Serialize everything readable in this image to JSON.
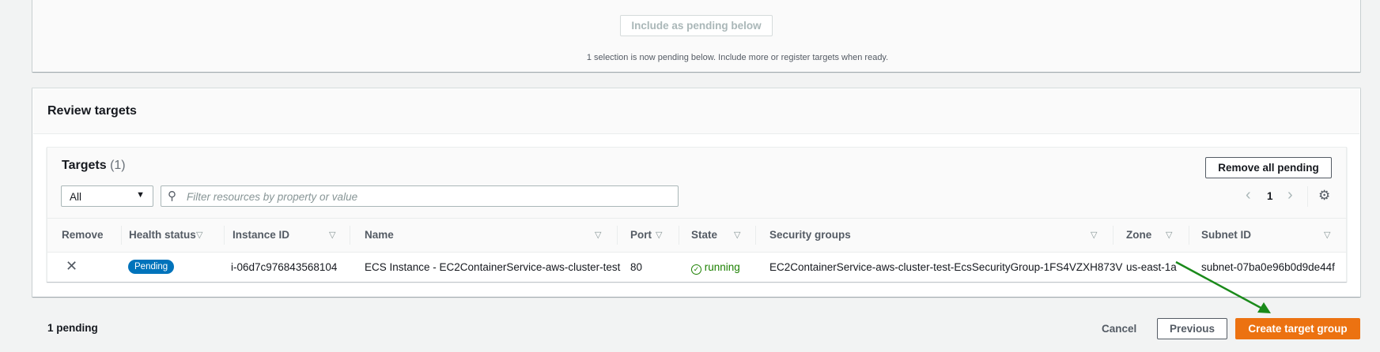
{
  "top_panel": {
    "include_button": "Include as pending below",
    "selection_text": "1 selection is now pending below. Include more or register targets when ready."
  },
  "review": {
    "title": "Review targets",
    "targets_title": "Targets",
    "targets_count": "(1)",
    "remove_all_button": "Remove all pending",
    "filter_select": "All",
    "filter_placeholder": "Filter resources by property or value",
    "page": "1",
    "columns": [
      "Remove",
      "Health status",
      "Instance ID",
      "Name",
      "Port",
      "State",
      "Security groups",
      "Zone",
      "Subnet ID"
    ],
    "rows": [
      {
        "health": "Pending",
        "instance_id": "i-06d7c976843568104",
        "name": "ECS Instance - EC2ContainerService-aws-cluster-test",
        "port": "80",
        "state": "running",
        "security_groups": "EC2ContainerService-aws-cluster-test-EcsSecurityGroup-1FS4VZXH873V",
        "zone": "us-east-1a",
        "subnet_id": "subnet-07ba0e96b0d9de44f"
      }
    ]
  },
  "footer": {
    "pending_count": "1 pending",
    "cancel": "Cancel",
    "previous": "Previous",
    "create": "Create target group"
  },
  "colors": {
    "primary": "#ec7211",
    "pending_badge": "#0073bb",
    "running": "#1d8102",
    "arrow": "#1a8a1a"
  }
}
